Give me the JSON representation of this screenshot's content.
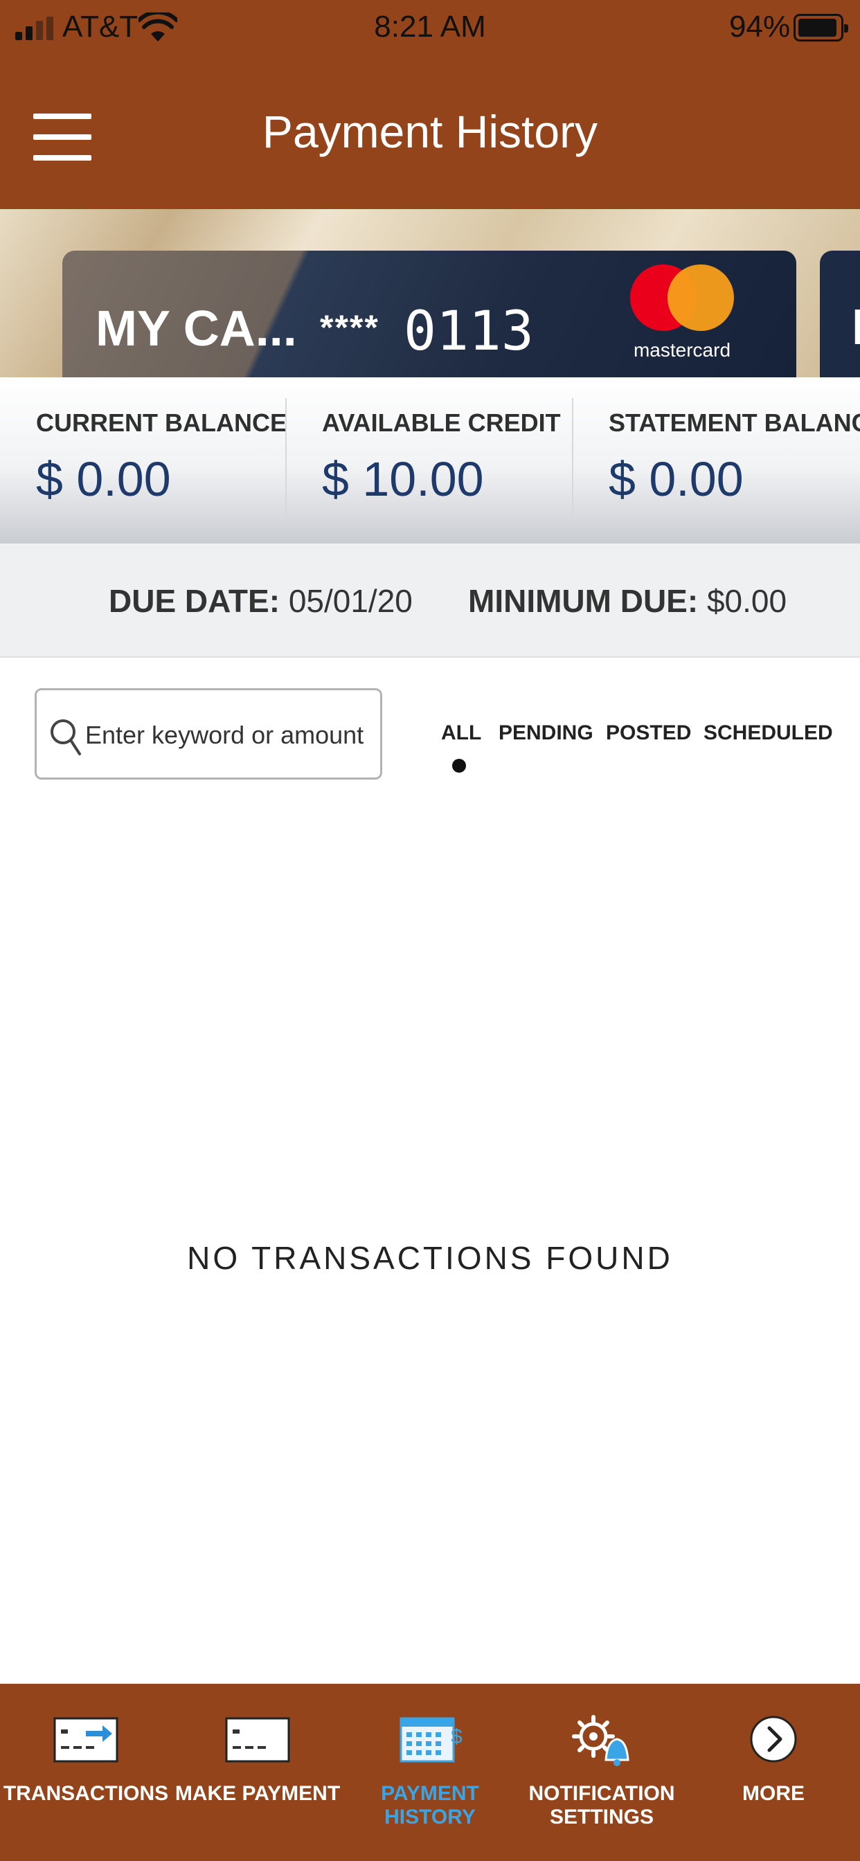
{
  "status_bar": {
    "carrier": "AT&T",
    "time": "8:21 AM",
    "battery_percent": "94%"
  },
  "header": {
    "title": "Payment History",
    "menu_icon": "hamburger-menu-icon"
  },
  "card": {
    "name": "MY CA...",
    "masked": "****",
    "last_digits": "0113",
    "network": "mastercard",
    "next_card_partial": "M"
  },
  "balances": {
    "current": {
      "label": "CURRENT BALANCE",
      "value": "$ 0.00"
    },
    "available": {
      "label": "AVAILABLE CREDIT",
      "value": "$ 10.00"
    },
    "statement": {
      "label": "STATEMENT BALANCE",
      "value": "$ 0.00"
    }
  },
  "due": {
    "date_label": "DUE DATE:",
    "date_value": "05/01/20",
    "minimum_label": "MINIMUM DUE:",
    "minimum_value": "$0.00"
  },
  "search": {
    "placeholder": "Enter keyword or amount",
    "value": ""
  },
  "filters": {
    "all": "ALL",
    "pending": "PENDING",
    "posted": "POSTED",
    "scheduled": "SCHEDULED",
    "selected": "ALL"
  },
  "empty_state": "NO TRANSACTIONS FOUND",
  "bottom_nav": {
    "transactions": "TRANSACTIONS",
    "make_payment": "MAKE PAYMENT",
    "payment_history_line1": "PAYMENT",
    "payment_history_line2": "HISTORY",
    "notification_line1": "NOTIFICATION",
    "notification_line2": "SETTINGS",
    "more": "MORE",
    "active": "PAYMENT HISTORY"
  },
  "colors": {
    "brand": "#94441a",
    "balance_value": "#1d3a6b",
    "active_nav": "#3aa5e6",
    "mastercard_red": "#eb001b",
    "mastercard_yellow": "#f79e1b"
  }
}
